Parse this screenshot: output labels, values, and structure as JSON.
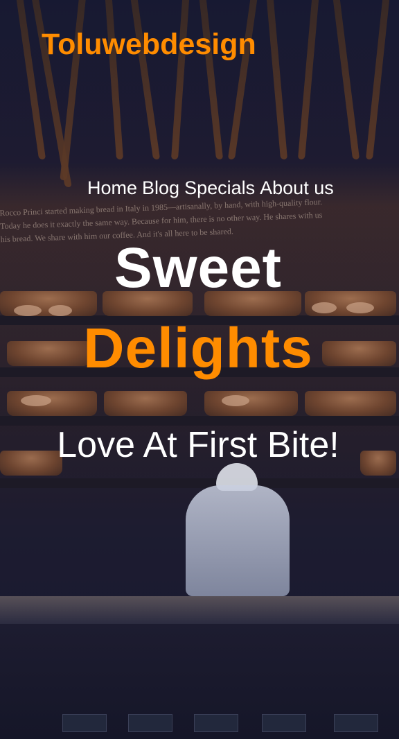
{
  "brand": {
    "name": "Toluwebdesign",
    "color": "#ff8c00"
  },
  "nav": {
    "items": [
      {
        "label": "Home"
      },
      {
        "label": "Blog"
      },
      {
        "label": "Specials"
      },
      {
        "label": "About us"
      }
    ]
  },
  "hero": {
    "title_line1": "Sweet",
    "title_line2": "Delights",
    "tagline": "Love At First Bite!",
    "background_image": "bakery-interior-photo",
    "wall_text": "Rocco Princi started making bread in Italy in 1985—artisanally, by hand, with high-quality flour. Today he does it exactly the same way. Because for him, there is no other way. He shares with us his bread. We share with him our coffee. And it's all here to be shared."
  },
  "colors": {
    "accent": "#ff8c00",
    "text": "#ffffff"
  }
}
